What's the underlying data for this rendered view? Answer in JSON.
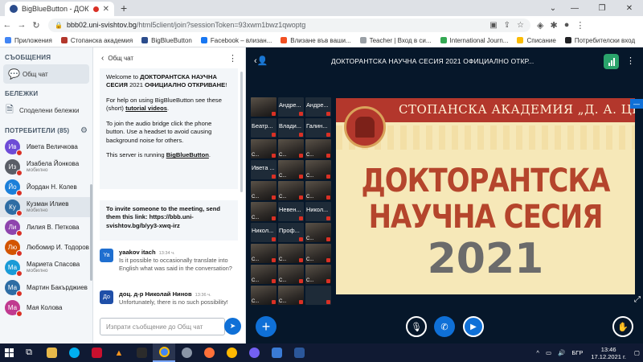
{
  "browser": {
    "tab_title": "BigBlueButton - ДОКТОРАНТ",
    "url_host": "bbb02.uni-svishtov.bg",
    "url_path": "/html5client/join?sessionToken=93xwm1bwz1qwoptg",
    "new_tab_label": "+",
    "bookmarks": [
      "Приложения",
      "Стопанска академия",
      "BigBlueButton",
      "Facebook – влизан...",
      "Влизане във ваши...",
      "Teacher | Вход в си...",
      "International Journ...",
      "Списание",
      "Потребителски вход"
    ],
    "bookmark_colors": [
      "#4285f4",
      "#b3372c",
      "#2b4c8c",
      "#1877f2",
      "#f25022",
      "#9aa0a6",
      "#34a853",
      "#fbbc05",
      "#202124"
    ]
  },
  "sidebar": {
    "messages_title": "СЪОБЩЕНИЯ",
    "public_chat": "Общ чат",
    "notes_title": "БЕЛЕЖКИ",
    "shared_notes": "Споделени бележки",
    "users_title": "ПОТРЕБИТЕЛИ (85)",
    "users": [
      {
        "initials": "Ив",
        "name": "Ивета Величкова",
        "sub": "",
        "color": "#6d4bd6"
      },
      {
        "initials": "Из",
        "name": "Изабела Йонкова",
        "sub": "мобилно",
        "color": "#5a5e66"
      },
      {
        "initials": "Йо",
        "name": "Йордан Н. Колев",
        "sub": "",
        "color": "#1b7fd9"
      },
      {
        "initials": "Ку",
        "name": "Кузман Илиев",
        "sub": "мобилно",
        "color": "#2e6da4"
      },
      {
        "initials": "Ли",
        "name": "Лилия В. Петкова",
        "sub": "",
        "color": "#8e44ad"
      },
      {
        "initials": "Лю",
        "name": "Любомир И. Тодоров",
        "sub": "",
        "color": "#d35400"
      },
      {
        "initials": "Ма",
        "name": "Мариета Спасова",
        "sub": "мобилно",
        "color": "#1a9bd7"
      },
      {
        "initials": "Ма",
        "name": "Мартин Бакърджиев",
        "sub": "",
        "color": "#2e6da4"
      },
      {
        "initials": "Ма",
        "name": "Мая Колова",
        "sub": "",
        "color": "#c0398f"
      }
    ]
  },
  "chat": {
    "title": "Общ чат",
    "welcome_1a": "Welcome to ",
    "welcome_1b": "ДОКТОРАНТСКА НАУЧНА СЕСИЯ",
    "welcome_1c": " 2021 ",
    "welcome_1d": "ОФИЦИАЛНО ОТКРИВАНЕ",
    "welcome_1e": "!",
    "welcome_2a": "For help on using BigBlueButton see these (short) ",
    "welcome_2link": "tutorial videos",
    "welcome_2b": ".",
    "welcome_3": "To join the audio bridge click the phone button. Use a headset to avoid causing background noise for others.",
    "welcome_4a": "This server is running ",
    "welcome_4link": "BigBlueButton",
    "welcome_4b": ".",
    "invite_text": "To invite someone to the meeting, send them this link: https://bbb.uni-svishtov.bg/b/yy3-xwq-irz",
    "messages": [
      {
        "initials": "Ya",
        "from": "yaakov itach",
        "time": "13:34 ч.",
        "text": "Is it possible to occasionally translate into English what was said in the conversation?",
        "color": "#1f6fd0"
      },
      {
        "initials": "До",
        "from": "доц. д-р Николай Нинов",
        "time": "13:36 ч.",
        "text": "Unfortunately, there is no such possibility!",
        "color": "#1f4fa8"
      }
    ],
    "input_placeholder": "Изпрати съобщение до Общ чат"
  },
  "stage": {
    "meeting_title": "ДОКТОРАНТСКА НАУЧНА СЕСИЯ 2021 ОФИЦИАЛНО ОТКР...",
    "tiles": [
      {
        "label": "",
        "video": true
      },
      {
        "label": "Андре...",
        "video": false
      },
      {
        "label": "Андре...",
        "video": false
      },
      {
        "label": "Беатр...",
        "video": false
      },
      {
        "label": "Влади...",
        "video": false
      },
      {
        "label": "Галин...",
        "video": false
      },
      {
        "label": "С...",
        "video": true
      },
      {
        "label": "С...",
        "video": true
      },
      {
        "label": "С...",
        "video": true
      },
      {
        "label": "Ивета ...",
        "video": false
      },
      {
        "label": "С...",
        "video": true
      },
      {
        "label": "С...",
        "video": true
      },
      {
        "label": "С...",
        "video": true
      },
      {
        "label": "С...",
        "video": true
      },
      {
        "label": "С...",
        "video": true
      },
      {
        "label": "С...",
        "video": true
      },
      {
        "label": "Невен...",
        "video": false
      },
      {
        "label": "Никол...",
        "video": false
      },
      {
        "label": "Никол...",
        "video": false
      },
      {
        "label": "Проф...",
        "video": false
      },
      {
        "label": "С...",
        "video": true
      },
      {
        "label": "С...",
        "video": true
      },
      {
        "label": "С...",
        "video": true
      },
      {
        "label": "С...",
        "video": true
      },
      {
        "label": "С...",
        "video": true
      },
      {
        "label": "С...",
        "video": true
      },
      {
        "label": "С...",
        "video": true
      },
      {
        "label": "С...",
        "video": true
      },
      {
        "label": "С...",
        "video": true
      },
      {
        "label": "",
        "video": false
      }
    ],
    "slide": {
      "org_name": "СТОПАНСКА АКАДЕМИЯ „Д. А. ЦЕНОВ“",
      "line1": "ДОКТОРАНТСКА",
      "line2": "НАУЧНА СЕСИЯ",
      "year": "2021"
    }
  },
  "taskbar": {
    "lang": "БГР",
    "time": "13:46",
    "date": "17.12.2021 г."
  }
}
